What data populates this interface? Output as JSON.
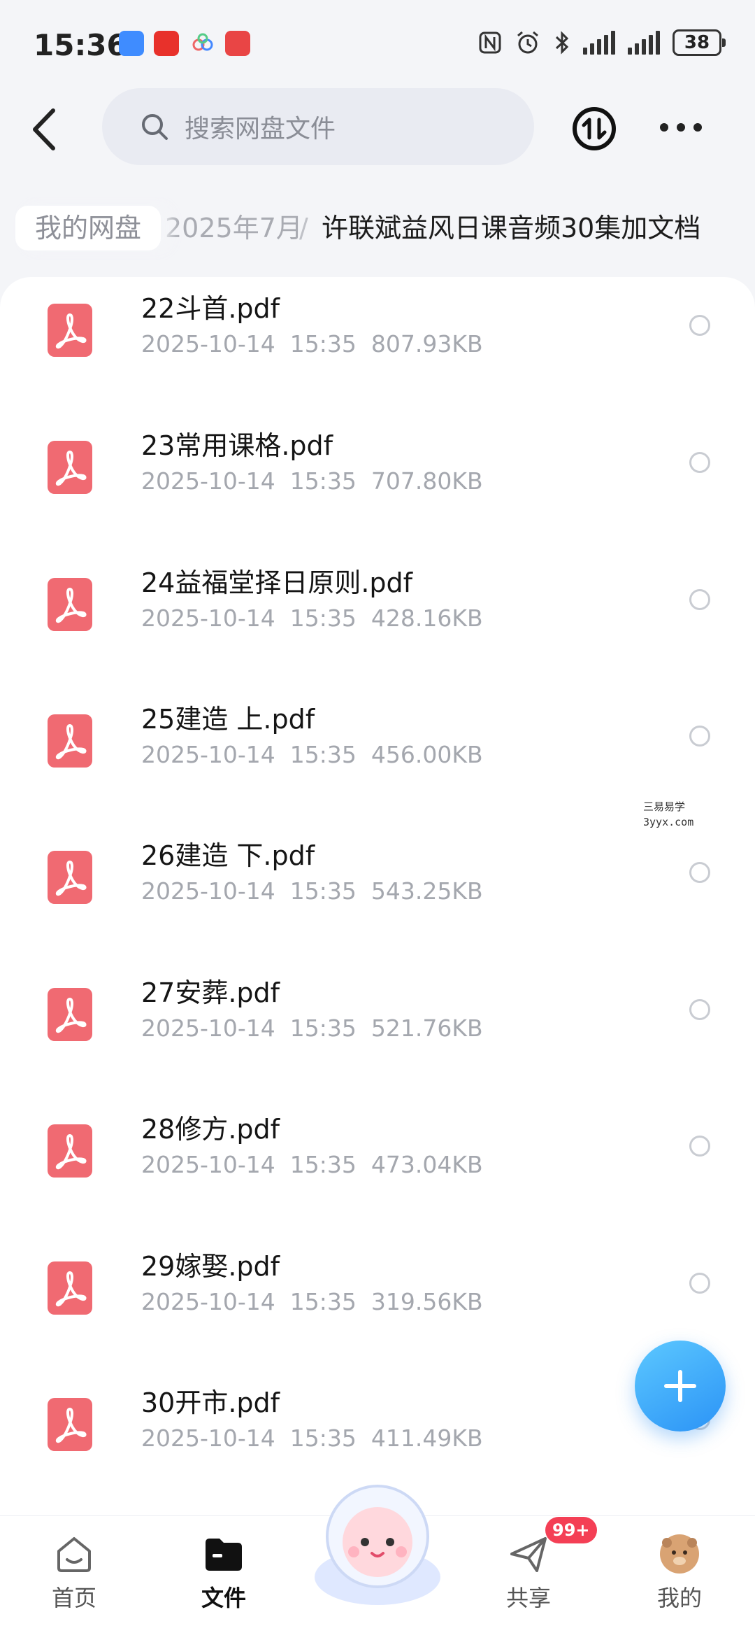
{
  "status_bar": {
    "time": "15:36",
    "battery": "38"
  },
  "header": {
    "search_placeholder": "搜索网盘文件"
  },
  "breadcrumb": {
    "root": "我的网盘",
    "parent": "2025年7月",
    "separator": "/",
    "current": "许联斌益风日课音频30集加文档"
  },
  "files": [
    {
      "name": "22斗首.pdf",
      "date": "2025-10-14",
      "time": "15:35",
      "size": "807.93KB"
    },
    {
      "name": "23常用课格.pdf",
      "date": "2025-10-14",
      "time": "15:35",
      "size": "707.80KB"
    },
    {
      "name": "24益福堂择日原则.pdf",
      "date": "2025-10-14",
      "time": "15:35",
      "size": "428.16KB"
    },
    {
      "name": "25建造 上.pdf",
      "date": "2025-10-14",
      "time": "15:35",
      "size": "456.00KB"
    },
    {
      "name": "26建造 下.pdf",
      "date": "2025-10-14",
      "time": "15:35",
      "size": "543.25KB"
    },
    {
      "name": "27安葬.pdf",
      "date": "2025-10-14",
      "time": "15:35",
      "size": "521.76KB"
    },
    {
      "name": "28修方.pdf",
      "date": "2025-10-14",
      "time": "15:35",
      "size": "473.04KB"
    },
    {
      "name": "29嫁娶.pdf",
      "date": "2025-10-14",
      "time": "15:35",
      "size": "319.56KB"
    },
    {
      "name": "30开市.pdf",
      "date": "2025-10-14",
      "time": "15:35",
      "size": "411.49KB"
    }
  ],
  "watermark": {
    "line1": "三易易学",
    "line2": "3yyx.com"
  },
  "bottom_nav": {
    "home": "首页",
    "files": "文件",
    "share": "共享",
    "share_badge": "99+",
    "mine": "我的"
  },
  "colors": {
    "accent": "#2b93f6",
    "pdf_icon": "#f06a72",
    "badge": "#f43f55"
  },
  "icons": {
    "back": "chevron-left-icon",
    "search": "search-icon",
    "transfer": "transfer-icon",
    "more": "more-icon",
    "file": "pdf-file-icon",
    "add": "plus-icon"
  }
}
